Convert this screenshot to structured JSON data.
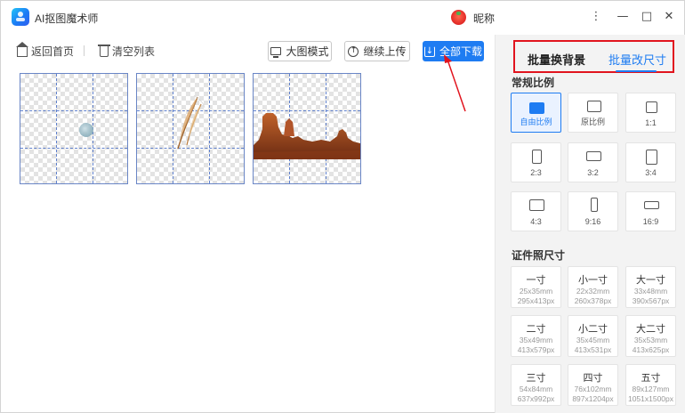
{
  "app": {
    "title": "AI抠图魔术师",
    "user_name": "昵称"
  },
  "window": {
    "menu_glyph": "⋮",
    "min_glyph": "—",
    "max_glyph": "□",
    "close_glyph": "✕"
  },
  "toolbar": {
    "home_label": "返回首页",
    "clear_label": "清空列表",
    "big_mode_label": "大图模式",
    "upload_label": "继续上传",
    "download_all_label": "全部下载",
    "upload_glyph": "↑",
    "download_glyph": "↓"
  },
  "images": [
    {
      "subject": "moon",
      "icon": "moon-image"
    },
    {
      "subject": "feather",
      "icon": "feather-image"
    },
    {
      "subject": "desert-rocks",
      "icon": "desert-image"
    }
  ],
  "panel": {
    "tabs": [
      {
        "label": "批量换背景",
        "active": false
      },
      {
        "label": "批量改尺寸",
        "active": true
      }
    ],
    "ratio_title": "常规比例",
    "ratios": [
      {
        "label": "自由比例",
        "selected": true
      },
      {
        "label": "原比例",
        "selected": false
      },
      {
        "label": "1:1",
        "selected": false
      },
      {
        "label": "2:3",
        "selected": false
      },
      {
        "label": "3:2",
        "selected": false
      },
      {
        "label": "3:4",
        "selected": false
      },
      {
        "label": "4:3",
        "selected": false
      },
      {
        "label": "9:16",
        "selected": false
      },
      {
        "label": "16:9",
        "selected": false
      }
    ],
    "id_title": "证件照尺寸",
    "id_sizes": [
      {
        "name": "一寸",
        "mm": "25x35mm",
        "px": "295x413px"
      },
      {
        "name": "小一寸",
        "mm": "22x32mm",
        "px": "260x378px"
      },
      {
        "name": "大一寸",
        "mm": "33x48mm",
        "px": "390x567px"
      },
      {
        "name": "二寸",
        "mm": "35x49mm",
        "px": "413x579px"
      },
      {
        "name": "小二寸",
        "mm": "35x45mm",
        "px": "413x531px"
      },
      {
        "name": "大二寸",
        "mm": "35x53mm",
        "px": "413x625px"
      },
      {
        "name": "三寸",
        "mm": "54x84mm",
        "px": "637x992px"
      },
      {
        "name": "四寸",
        "mm": "76x102mm",
        "px": "897x1204px"
      },
      {
        "name": "五寸",
        "mm": "89x127mm",
        "px": "1051x1500px"
      }
    ]
  },
  "colors": {
    "accent": "#1e7cf2",
    "annotation_red": "#e1141e",
    "panel_bg": "#f3f3f3"
  }
}
